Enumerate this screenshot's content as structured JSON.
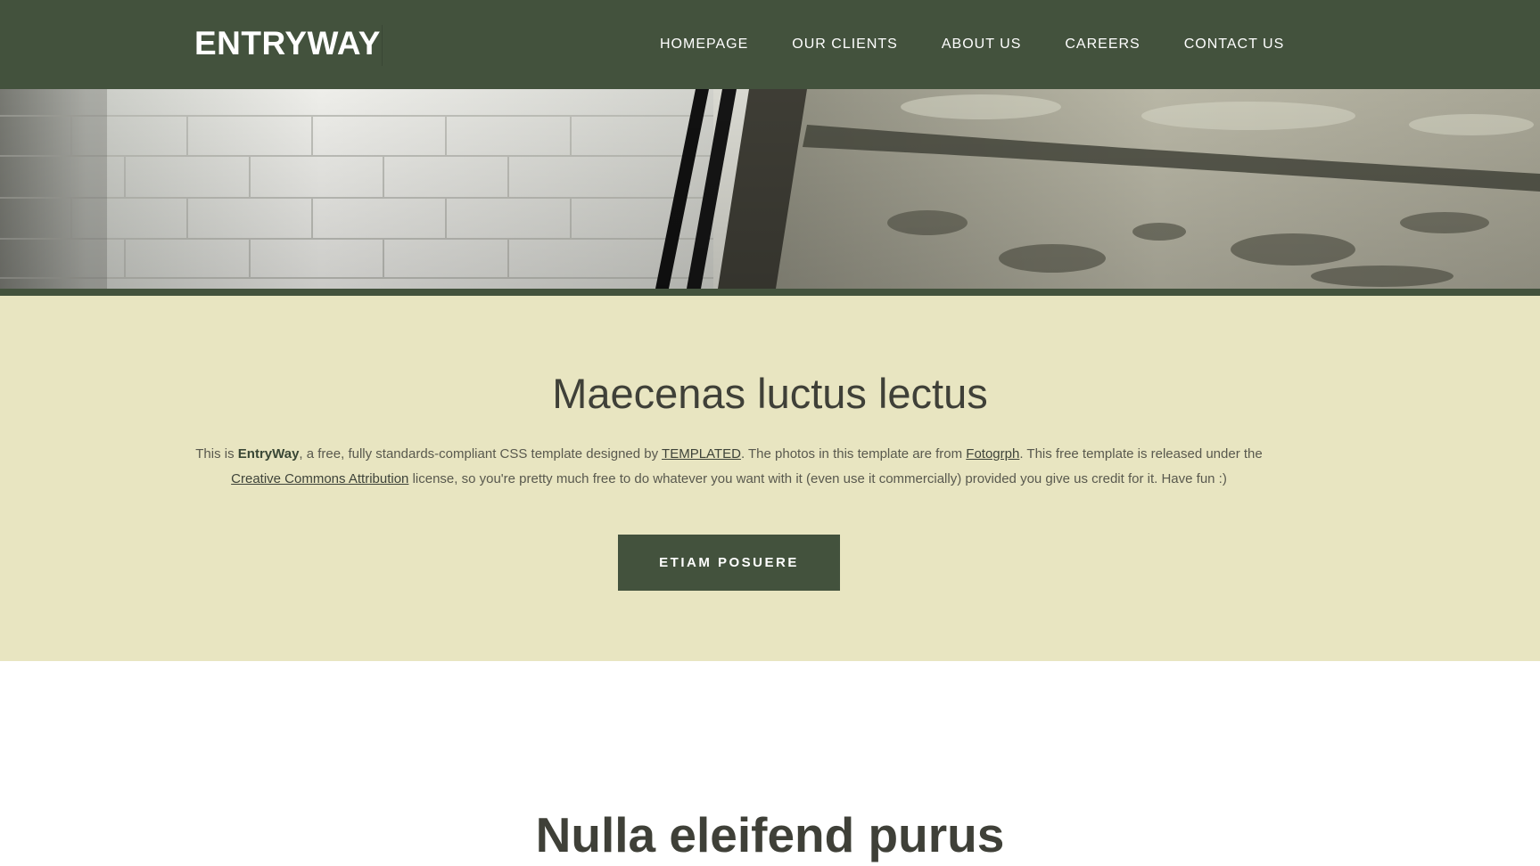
{
  "header": {
    "logo": "ENTRYWAY",
    "nav": [
      "HOMEPAGE",
      "OUR CLIENTS",
      "ABOUT US",
      "CAREERS",
      "CONTACT US"
    ]
  },
  "featured": {
    "title": "Maecenas luctus lectus",
    "text": {
      "p1": "This is ",
      "brand": "EntryWay",
      "p2": ", a free, fully standards-compliant CSS template designed by ",
      "link1": "TEMPLATED",
      "p3": ". The photos in this template are from ",
      "link2": "Fotogrph",
      "p4": ". This free template is released under the ",
      "link3": "Creative Commons Attribution",
      "p5": " license, so you're pretty much free to do whatever you want with it (even use it commercially) provided you give us credit for it. Have fun :)"
    },
    "button": "ETIAM POSUERE"
  },
  "next_section": {
    "title": "Nulla eleifend purus"
  },
  "colors": {
    "header_bg": "#43523d",
    "featured_bg": "#e8e5c1",
    "button_bg": "#43523d",
    "text_dark": "#3f4038"
  }
}
